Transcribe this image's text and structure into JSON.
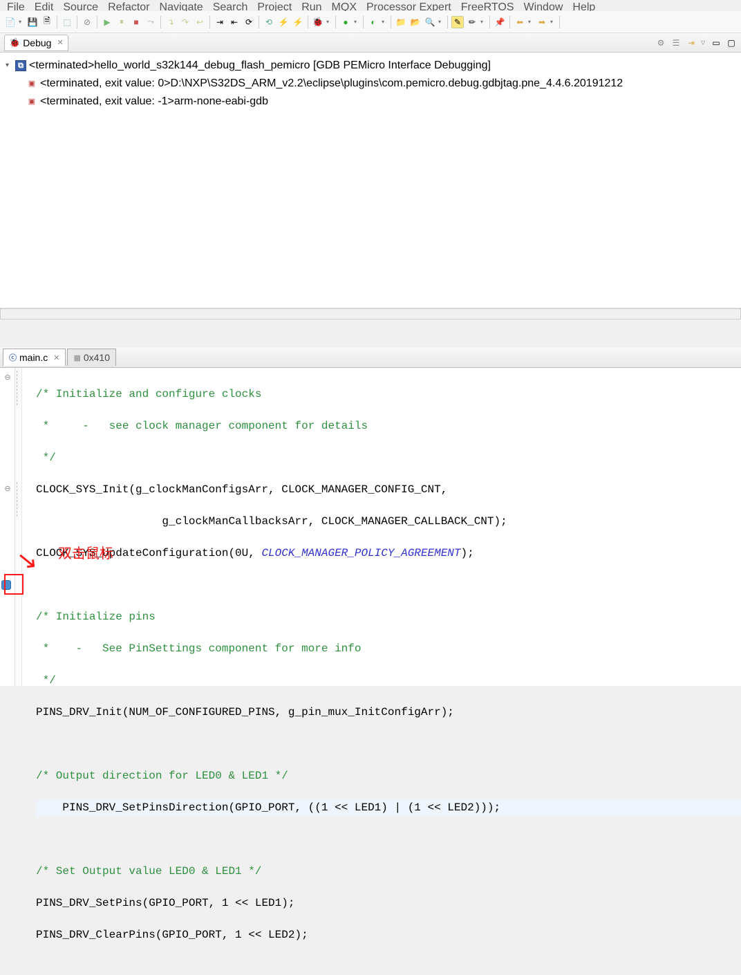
{
  "menu": {
    "items": [
      "File",
      "Edit",
      "Source",
      "Refactor",
      "Navigate",
      "Search",
      "Project",
      "Run",
      "MQX",
      "Processor Expert",
      "FreeRTOS",
      "Window",
      "Help"
    ]
  },
  "debug": {
    "tab_label": "Debug",
    "launch": "<terminated>hello_world_s32k144_debug_flash_pemicro [GDB PEMicro Interface Debugging]",
    "proc1": "<terminated, exit value: 0>D:\\NXP\\S32DS_ARM_v2.2\\eclipse\\plugins\\com.pemicro.debug.gdbjtag.pne_4.4.6.20191212",
    "proc2": "<terminated, exit value: -1>arm-none-eabi-gdb"
  },
  "editor": {
    "tab1": "main.c",
    "tab2": "0x410",
    "code": {
      "l1": "/* Initialize and configure clocks",
      "l2": " *     -   see clock manager component for details",
      "l3": " */",
      "l4a": "CLOCK_SYS_Init(g_clockManConfigsArr, CLOCK_MANAGER_CONFIG_CNT,",
      "l4b": "                   g_clockManCallbacksArr, CLOCK_MANAGER_CALLBACK_CNT);",
      "l5a": "CLOCK_SYS_UpdateConfiguration(0U, ",
      "l5b": "CLOCK_MANAGER_POLICY_AGREEMENT",
      "l5c": ");",
      "l6": "/* Initialize pins",
      "l7": " *    -   See PinSettings component for more info",
      "l8": " */",
      "l9": "PINS_DRV_Init(NUM_OF_CONFIGURED_PINS, g_pin_mux_InitConfigArr);",
      "l10": "/* Output direction for LED0 & LED1 */",
      "l11": "    PINS_DRV_SetPinsDirection(GPIO_PORT, ((1 << LED1) | (1 << LED2)));",
      "l12": "/* Set Output value LED0 & LED1 */",
      "l13": "PINS_DRV_SetPins(GPIO_PORT, 1 << LED1);",
      "l14": "PINS_DRV_ClearPins(GPIO_PORT, 1 << LED2);"
    }
  },
  "annotation": {
    "text": "双击鼠标"
  }
}
